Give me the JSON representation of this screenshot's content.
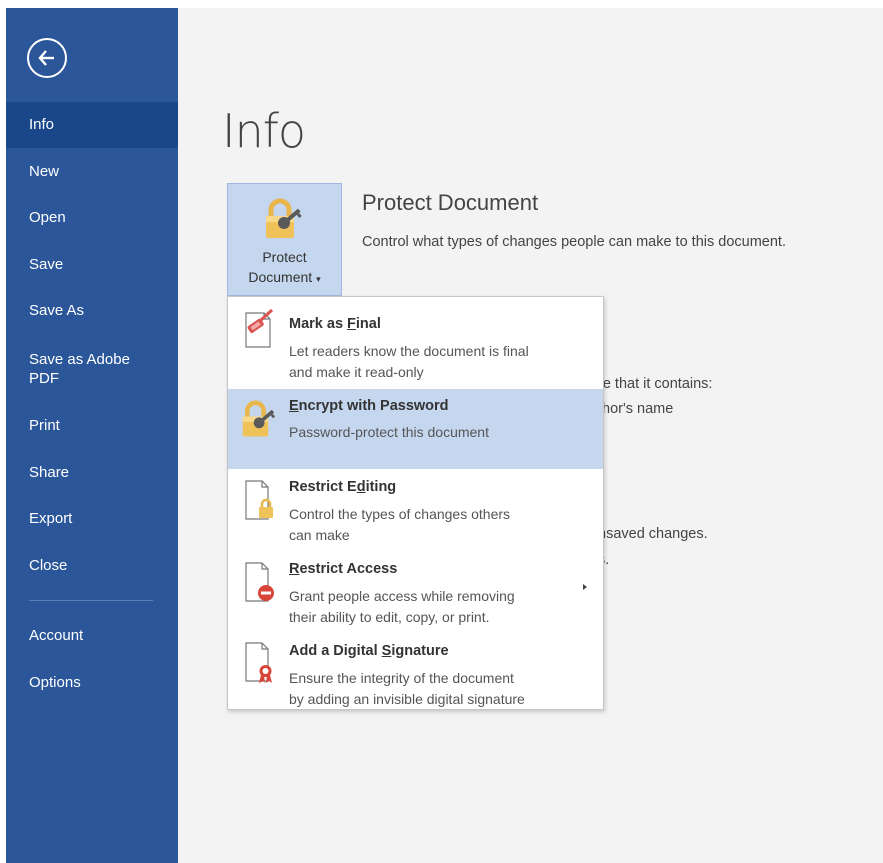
{
  "sidebar": {
    "items": [
      {
        "label": "Info"
      },
      {
        "label": "New"
      },
      {
        "label": "Open"
      },
      {
        "label": "Save"
      },
      {
        "label": "Save As"
      },
      {
        "label": "Save as Adobe PDF"
      },
      {
        "label": "Print"
      },
      {
        "label": "Share"
      },
      {
        "label": "Export"
      },
      {
        "label": "Close"
      },
      {
        "label": "Account"
      },
      {
        "label": "Options"
      }
    ]
  },
  "main": {
    "title": "Info",
    "protect_button": {
      "line1": "Protect",
      "line2": "Document"
    },
    "protect_section": {
      "title": "Protect Document",
      "description": "Control what types of changes people can make to this document."
    },
    "partial_text": {
      "line1": "re that it contains:",
      "line2": "thor's name",
      "line3": "nsaved changes.",
      "line4": "s."
    }
  },
  "menu": {
    "items": [
      {
        "title_pre": "Mark as ",
        "title_key": "F",
        "title_post": "inal",
        "desc1": "Let readers know the document is final",
        "desc2": "and make it read-only"
      },
      {
        "title_pre": "",
        "title_key": "E",
        "title_post": "ncrypt with Password",
        "desc1": "Password-protect this document",
        "desc2": ""
      },
      {
        "title_pre": "Restrict E",
        "title_key": "d",
        "title_post": "iting",
        "desc1": "Control the types of changes others",
        "desc2": "can make"
      },
      {
        "title_pre": "",
        "title_key": "R",
        "title_post": "estrict Access",
        "desc1": "Grant people access while removing",
        "desc2": "their ability to edit, copy, or print."
      },
      {
        "title_pre": "Add a Digital ",
        "title_key": "S",
        "title_post": "ignature",
        "desc1": "Ensure the integrity of the document",
        "desc2": "by adding an invisible digital signature"
      }
    ]
  },
  "colors": {
    "sidebar_bg": "#2b579a",
    "sidebar_active": "#19478a",
    "highlight": "#c5d7ef",
    "page_bg": "#f3f3f3"
  }
}
